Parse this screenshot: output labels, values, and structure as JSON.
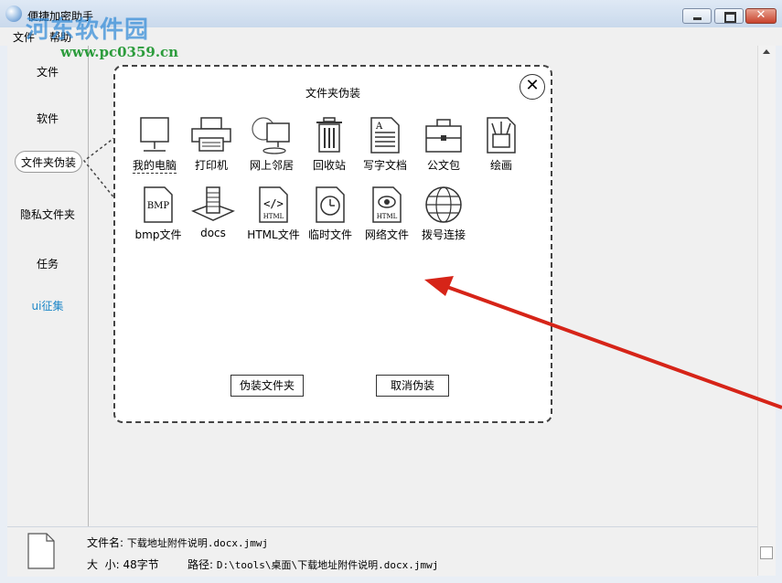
{
  "window": {
    "title": "便捷加密助手",
    "watermark": "河东软件园",
    "watermark_url": "www.pc0359.cn",
    "controls": {
      "minimize": "minimize",
      "maximize": "maximize",
      "close": "✕"
    }
  },
  "menu": [
    "文件",
    "帮助"
  ],
  "sidebar": [
    {
      "label": "文件"
    },
    {
      "label": "软件"
    },
    {
      "label": "文件夹伪装"
    },
    {
      "label": "隐私文件夹"
    },
    {
      "label": "任务"
    },
    {
      "label": "ui征集"
    }
  ],
  "dialog": {
    "title": "文件夹伪装",
    "icons": [
      {
        "label": "我的电脑",
        "icon": "computer-icon"
      },
      {
        "label": "打印机",
        "icon": "printer-icon"
      },
      {
        "label": "网上邻居",
        "icon": "network-icon"
      },
      {
        "label": "回收站",
        "icon": "recycle-bin-icon"
      },
      {
        "label": "写字文档",
        "icon": "document-icon"
      },
      {
        "label": "公文包",
        "icon": "briefcase-icon"
      },
      {
        "label": "绘画",
        "icon": "paint-icon"
      },
      {
        "label": "bmp文件",
        "icon": "bmp-file-icon",
        "text": "BMP"
      },
      {
        "label": "docs",
        "icon": "docs-icon"
      },
      {
        "label": "HTML文件",
        "icon": "html-file-icon",
        "text": "HTML"
      },
      {
        "label": "临时文件",
        "icon": "temp-file-icon"
      },
      {
        "label": "网络文件",
        "icon": "web-file-icon",
        "text": "HTML"
      },
      {
        "label": "拨号连接",
        "icon": "dialup-icon"
      }
    ],
    "document_glyph": "A",
    "disguise_button": "伪装文件夹",
    "cancel_button": "取消伪装"
  },
  "status": {
    "filename_label": "文件名:",
    "filename": "下载地址附件说明.docx.jmwj",
    "size_label": "大  小:",
    "size": "48字节",
    "path_label": "路径:",
    "path": "D:\\tools\\桌面\\下载地址附件说明.docx.jmwj"
  },
  "colors": {
    "link": "#1c86c7",
    "annotation_arrow": "#d62418"
  }
}
